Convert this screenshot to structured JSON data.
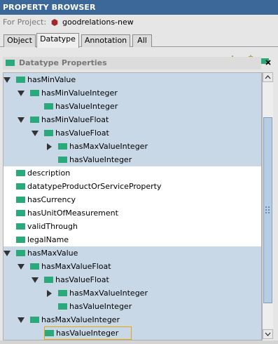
{
  "window": {
    "title": "PROPERTY BROWSER"
  },
  "project": {
    "label": "For Project:",
    "name": "goodrelations-new"
  },
  "tabs": [
    {
      "label": "Object"
    },
    {
      "label": "Datatype"
    },
    {
      "label": "Annotation"
    },
    {
      "label": "All"
    }
  ],
  "active_tab": "Datatype",
  "section": {
    "title": "Datatype Properties"
  },
  "toolbar_icons": [
    "create-property-icon",
    "create-subproperty-icon",
    "delete-property-icon"
  ],
  "tree": [
    {
      "label": "hasMinValue",
      "toggle": "expanded",
      "selected": true
    },
    {
      "label": "hasMinValueInteger",
      "toggle": "expanded",
      "selected": true
    },
    {
      "label": "hasValueInteger",
      "toggle": null,
      "selected": true
    },
    {
      "label": "hasMinValueFloat",
      "toggle": "expanded",
      "selected": true
    },
    {
      "label": "hasValueFloat",
      "toggle": "expanded",
      "selected": true
    },
    {
      "label": "hasMaxValueInteger",
      "toggle": "collapsed",
      "selected": true
    },
    {
      "label": "hasValueInteger",
      "toggle": null,
      "selected": true
    },
    {
      "label": "description",
      "toggle": null,
      "selected": false
    },
    {
      "label": "datatypeProductOrServiceProperty",
      "toggle": null,
      "selected": false
    },
    {
      "label": "hasCurrency",
      "toggle": null,
      "selected": false
    },
    {
      "label": "hasUnitOfMeasurement",
      "toggle": null,
      "selected": false
    },
    {
      "label": "validThrough",
      "toggle": null,
      "selected": false
    },
    {
      "label": "legalName",
      "toggle": null,
      "selected": false
    },
    {
      "label": "hasMaxValue",
      "toggle": "expanded",
      "selected": true
    },
    {
      "label": "hasMaxValueFloat",
      "toggle": "expanded",
      "selected": true
    },
    {
      "label": "hasValueFloat",
      "toggle": "expanded",
      "selected": true
    },
    {
      "label": "hasMaxValueInteger",
      "toggle": "collapsed",
      "selected": true
    },
    {
      "label": "hasValueInteger",
      "toggle": null,
      "selected": true
    },
    {
      "label": "hasMaxValueInteger",
      "toggle": "expanded",
      "selected": true
    },
    {
      "label": "hasValueInteger",
      "toggle": null,
      "selected": true,
      "focused": true
    }
  ],
  "colors": {
    "titlebar": "#3b6898",
    "property_icon": "#2aaa7a",
    "selection": "#c8d8e6",
    "focus_border": "#e0a800",
    "project_icon": "#a02828"
  }
}
